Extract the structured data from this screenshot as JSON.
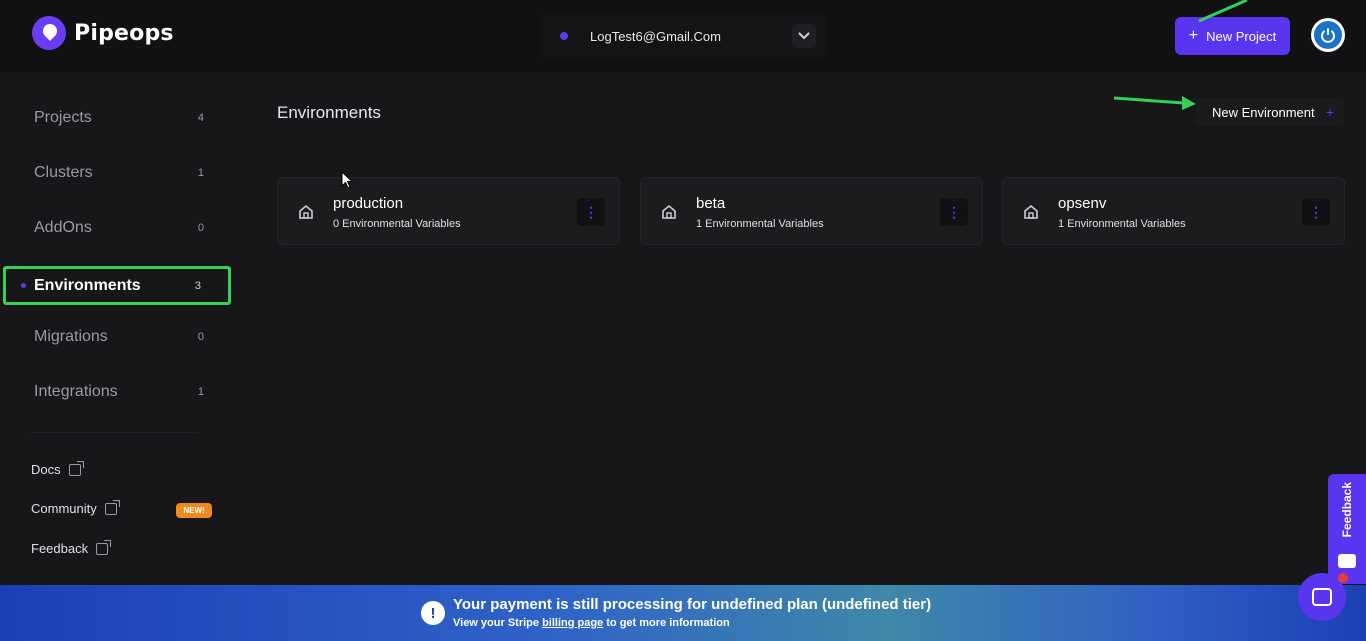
{
  "header": {
    "brand": "Pipeops",
    "account_email": "LogTest6@Gmail.Com",
    "new_project_label": "New Project"
  },
  "sidebar": {
    "items": [
      {
        "label": "Projects",
        "count": "4"
      },
      {
        "label": "Clusters",
        "count": "1"
      },
      {
        "label": "AddOns",
        "count": "0"
      },
      {
        "label": "Environments",
        "count": "3"
      },
      {
        "label": "Migrations",
        "count": "0"
      },
      {
        "label": "Integrations",
        "count": "1"
      }
    ],
    "links": [
      {
        "label": "Docs"
      },
      {
        "label": "Community",
        "badge": "NEW!"
      },
      {
        "label": "Feedback"
      }
    ]
  },
  "main": {
    "title": "Environments",
    "new_environment_label": "New Environment",
    "environments": [
      {
        "name": "production",
        "vars": "0 Environmental Variables"
      },
      {
        "name": "beta",
        "vars": "1 Environmental Variables"
      },
      {
        "name": "opsenv",
        "vars": "1 Environmental Variables"
      }
    ]
  },
  "banner": {
    "text": "Your payment is still processing for undefined plan (undefined tier)",
    "sub_before": "View your Stripe",
    "sub_link": "billing page",
    "sub_after": "to get more information"
  },
  "feedback_tab": {
    "label": "Feedback"
  },
  "colors": {
    "accent": "#5a35f0",
    "highlight": "#35d05a",
    "background": "#17171a"
  }
}
